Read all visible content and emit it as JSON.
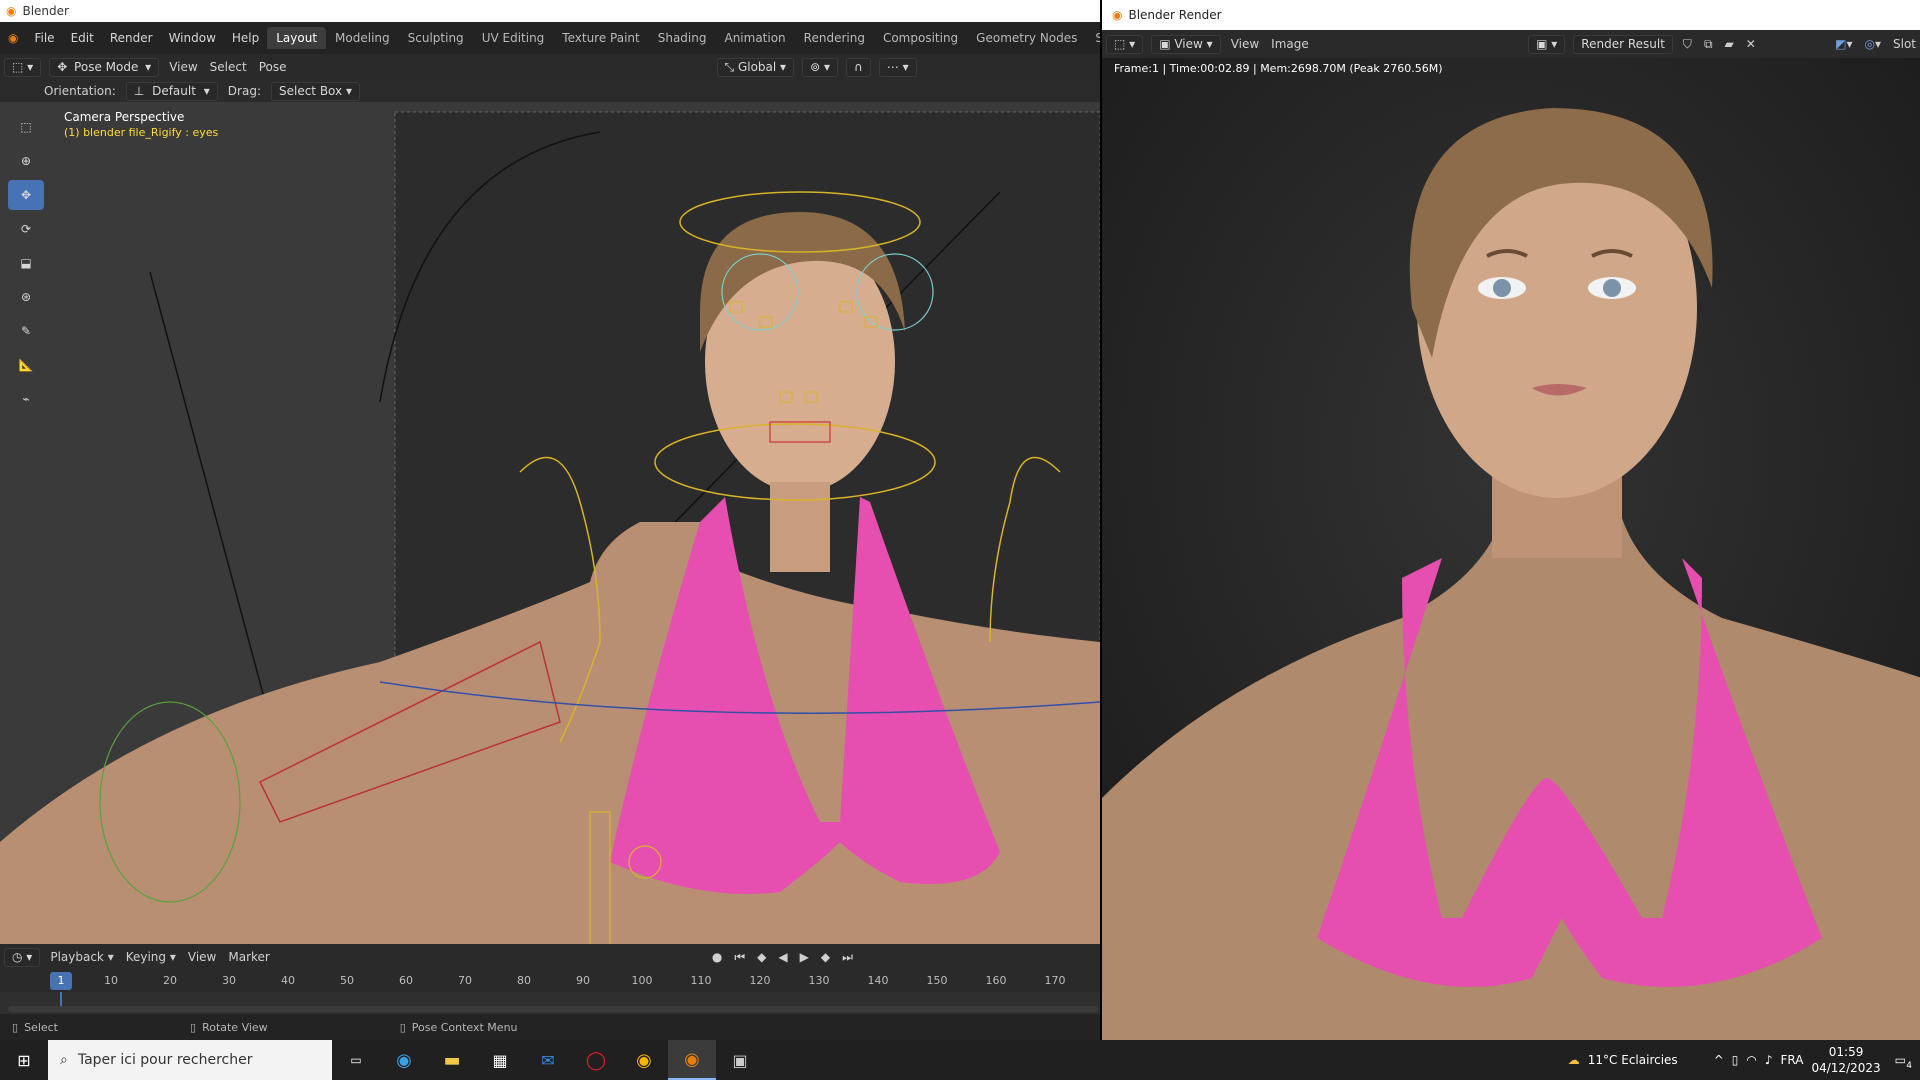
{
  "left_window": {
    "title": "Blender",
    "menu": [
      "File",
      "Edit",
      "Render",
      "Window",
      "Help"
    ],
    "workspaces": [
      "Layout",
      "Modeling",
      "Sculpting",
      "UV Editing",
      "Texture Paint",
      "Shading",
      "Animation",
      "Rendering",
      "Compositing",
      "Geometry Nodes",
      "Scripting"
    ],
    "active_workspace": "Layout",
    "add_workspace": "+",
    "viewport_header": {
      "mode": "Pose Mode",
      "view": "View",
      "select": "Select",
      "pose": "Pose",
      "transform_orientation": "Global"
    },
    "tool_header": {
      "orientation_label": "Orientation:",
      "orientation_value": "Default",
      "drag_label": "Drag:",
      "drag_value": "Select Box"
    },
    "viewport": {
      "camera_label": "Camera Perspective",
      "object_label": "(1) blender file_Rigify : eyes"
    },
    "timeline_header": {
      "playback": "Playback",
      "keying": "Keying",
      "view": "View",
      "marker": "Marker"
    },
    "timeline": {
      "current_frame": "1",
      "ticks": [
        "10",
        "20",
        "30",
        "40",
        "50",
        "60",
        "70",
        "80",
        "90",
        "100",
        "110",
        "120",
        "130",
        "140",
        "150",
        "160",
        "170"
      ]
    },
    "status_bar": {
      "select": "Select",
      "rotate": "Rotate View",
      "context": "Pose Context Menu"
    }
  },
  "right_window": {
    "title": "Blender Render",
    "header": {
      "view1": "View",
      "view2": "View",
      "image": "Image",
      "render_result": "Render Result",
      "slot": "Slot"
    },
    "stats": "Frame:1 | Time:00:02.89 | Mem:2698.70M (Peak 2760.56M)"
  },
  "taskbar": {
    "search_placeholder": "Taper ici pour rechercher",
    "weather": "11°C  Eclaircies",
    "language": "FRA",
    "time": "01:59",
    "date": "04/12/2023",
    "notifications": "4"
  },
  "colors": {
    "accent": "#4772b3",
    "object_label": "#ffdc3c",
    "bikini": "#e64fb0"
  }
}
